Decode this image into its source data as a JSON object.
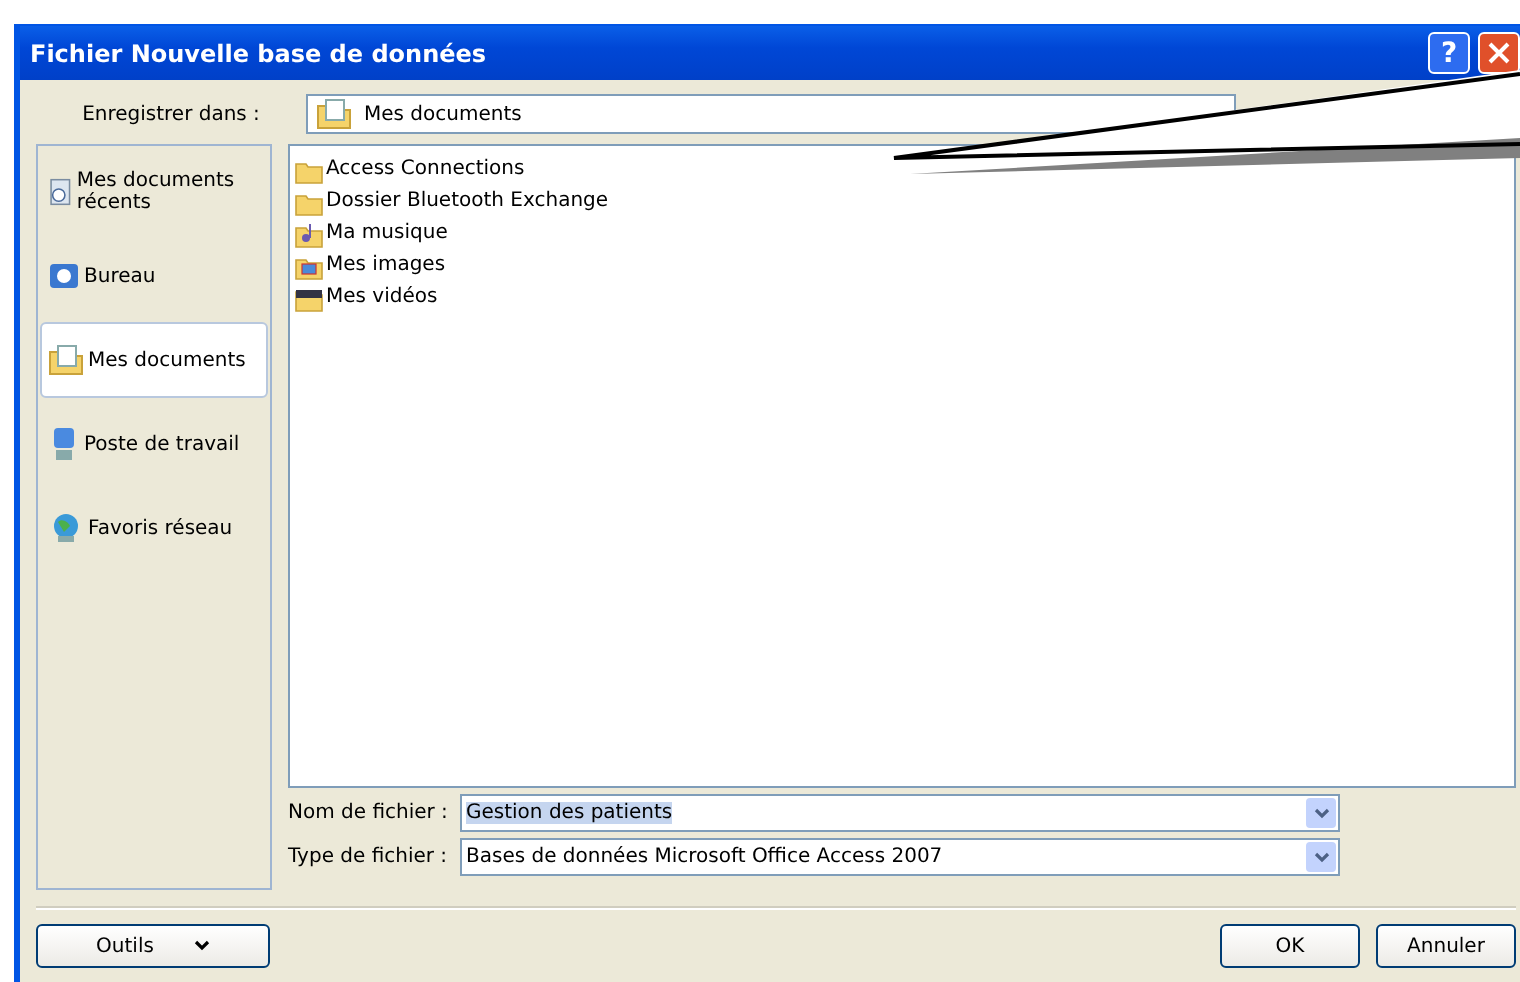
{
  "window": {
    "title": "Fichier Nouvelle base de données",
    "help": "?"
  },
  "save_in": {
    "label": "Enregistrer dans :",
    "value": "Mes documents"
  },
  "places": [
    {
      "label": "Mes documents récents",
      "kind": "recent",
      "selected": false
    },
    {
      "label": "Bureau",
      "kind": "desktop",
      "selected": false
    },
    {
      "label": "Mes documents",
      "kind": "documents",
      "selected": true
    },
    {
      "label": "Poste de travail",
      "kind": "computer",
      "selected": false
    },
    {
      "label": "Favoris réseau",
      "kind": "network",
      "selected": false
    }
  ],
  "files": [
    {
      "name": "Access Connections",
      "kind": "folder"
    },
    {
      "name": "Dossier Bluetooth Exchange",
      "kind": "folder"
    },
    {
      "name": "Ma musique",
      "kind": "music"
    },
    {
      "name": "Mes images",
      "kind": "images"
    },
    {
      "name": "Mes vidéos",
      "kind": "videos"
    }
  ],
  "file_name": {
    "label": "Nom de fichier :",
    "value": "Gestion des patients"
  },
  "file_type": {
    "label": "Type de fichier :",
    "value": "Bases de données Microsoft Office Access 2007"
  },
  "buttons": {
    "tools": "Outils",
    "ok": "OK",
    "cancel": "Annuler"
  }
}
